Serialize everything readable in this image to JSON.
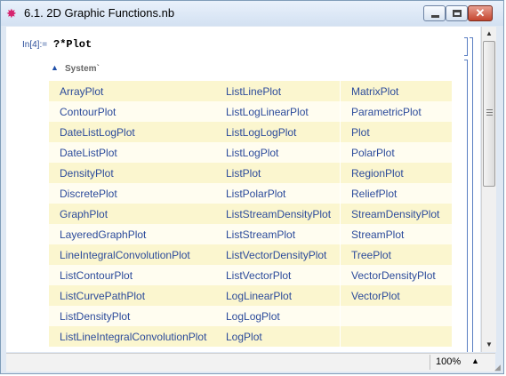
{
  "window": {
    "title": "6.1. 2D Graphic Functions.nb",
    "close_glyph": "✕"
  },
  "cell": {
    "in_label": "In[4]:=",
    "input": "?*Plot"
  },
  "result": {
    "context_label": "System`",
    "rows": [
      [
        "ArrayPlot",
        "ListLinePlot",
        "MatrixPlot"
      ],
      [
        "ContourPlot",
        "ListLogLinearPlot",
        "ParametricPlot"
      ],
      [
        "DateListLogPlot",
        "ListLogLogPlot",
        "Plot"
      ],
      [
        "DateListPlot",
        "ListLogPlot",
        "PolarPlot"
      ],
      [
        "DensityPlot",
        "ListPlot",
        "RegionPlot"
      ],
      [
        "DiscretePlot",
        "ListPolarPlot",
        "ReliefPlot"
      ],
      [
        "GraphPlot",
        "ListStreamDensityPlot",
        "StreamDensityPlot"
      ],
      [
        "LayeredGraphPlot",
        "ListStreamPlot",
        "StreamPlot"
      ],
      [
        "LineIntegralConvolutionPlot",
        "ListVectorDensityPlot",
        "TreePlot"
      ],
      [
        "ListContourPlot",
        "ListVectorPlot",
        "VectorDensityPlot"
      ],
      [
        "ListCurvePathPlot",
        "LogLinearPlot",
        "VectorPlot"
      ],
      [
        "ListDensityPlot",
        "LogLogPlot",
        ""
      ],
      [
        "ListLineIntegralConvolutionPlot",
        "LogPlot",
        ""
      ]
    ]
  },
  "status": {
    "zoom": "100%"
  },
  "icons": {
    "app": "mathematica-icon",
    "minimize": "minimize-icon",
    "maximize": "maximize-icon",
    "close": "close-icon",
    "context_toggle": "collapse-triangle-icon",
    "zoom_menu": "triangle-up-icon"
  },
  "colors": {
    "link": "#2c4b9b",
    "row_odd": "#fbf6cf",
    "row_even": "#fffdf0",
    "in_label": "#2b4f9a"
  }
}
